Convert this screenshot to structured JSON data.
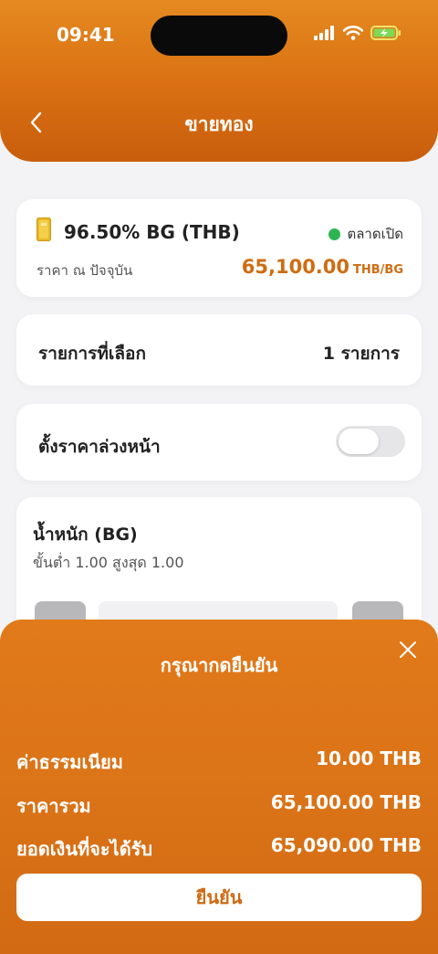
{
  "status_bar": {
    "time": "09:41"
  },
  "header": {
    "title": "ขายทอง"
  },
  "product": {
    "name": "96.50% BG (THB)",
    "market_status": "ตลาดเปิด",
    "price_label": "ราคา ณ ปัจจุบัน",
    "price_value": "65,100.00",
    "price_unit": "THB/BG"
  },
  "selection": {
    "label": "รายการที่เลือก",
    "value": "1 รายการ"
  },
  "preset": {
    "label": "ตั้งราคาล่วงหน้า",
    "enabled": false
  },
  "weight": {
    "title": "น้ำหนัก (BG)",
    "range": "ขั้นต่ำ 1.00   สูงสุด 1.00"
  },
  "confirm_sheet": {
    "title": "กรุณากดยืนยัน",
    "rows": [
      {
        "label": "ค่าธรรมเนียม",
        "value": "10.00 THB"
      },
      {
        "label": "ราคารวม",
        "value": "65,100.00 THB"
      },
      {
        "label": "ยอดเงินที่จะได้รับ",
        "value": "65,090.00 THB"
      }
    ],
    "confirm_label": "ยืนยัน"
  },
  "colors": {
    "brand_orange": "#dc7418",
    "price_orange": "#cf6c12",
    "market_open_green": "#2db552"
  }
}
